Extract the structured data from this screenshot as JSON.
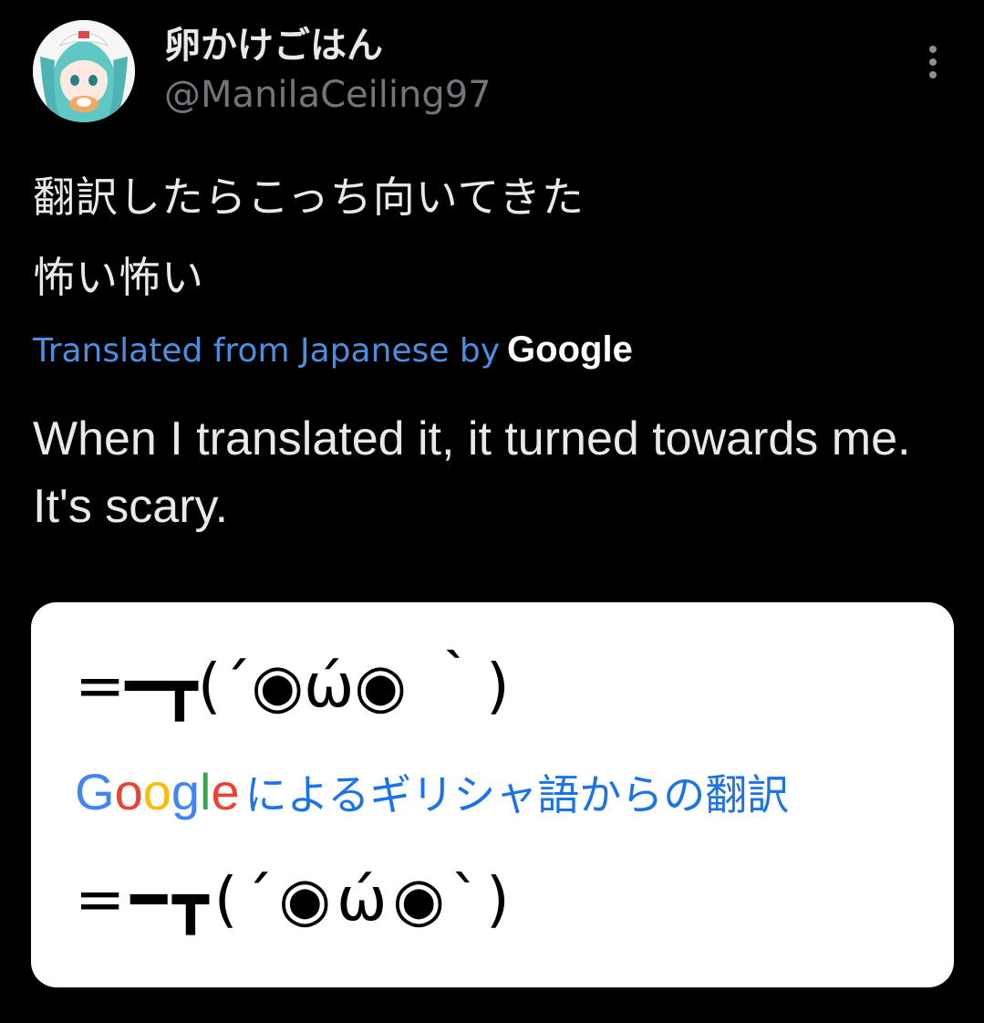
{
  "author": {
    "display_name": "卵かけごはん",
    "handle": "@ManilaCeiling97",
    "avatar_icon": "anime-avatar-icon"
  },
  "more_icon": "more-vertical-icon",
  "original_text": {
    "line1": "翻訳したらこっち向いてきた",
    "line2": "怖い怖い"
  },
  "translation_notice": {
    "text": "Translated from Japanese by",
    "provider": "Google",
    "link_color": "#4a8fe0"
  },
  "translated_text": "When I translated it, it turned towards me. It's scary.",
  "image_card": {
    "kaomoji_original": "=━┳(´◉ώ◉ ｀)",
    "google_logo_letters": [
      "G",
      "o",
      "o",
      "g",
      "l",
      "e"
    ],
    "caption": "によるギリシャ語からの翻訳",
    "kaomoji_translated": "=━┳(´◉ώ◉`)",
    "caption_color": "#1a73e8",
    "logo_colors": [
      "#4285f4",
      "#ea4335",
      "#fbbc05",
      "#4285f4",
      "#34a853",
      "#ea4335"
    ]
  },
  "colors": {
    "background": "#000000",
    "primary_text": "#e7e9ea",
    "secondary_text": "#71767b",
    "card_background": "#ffffff"
  }
}
